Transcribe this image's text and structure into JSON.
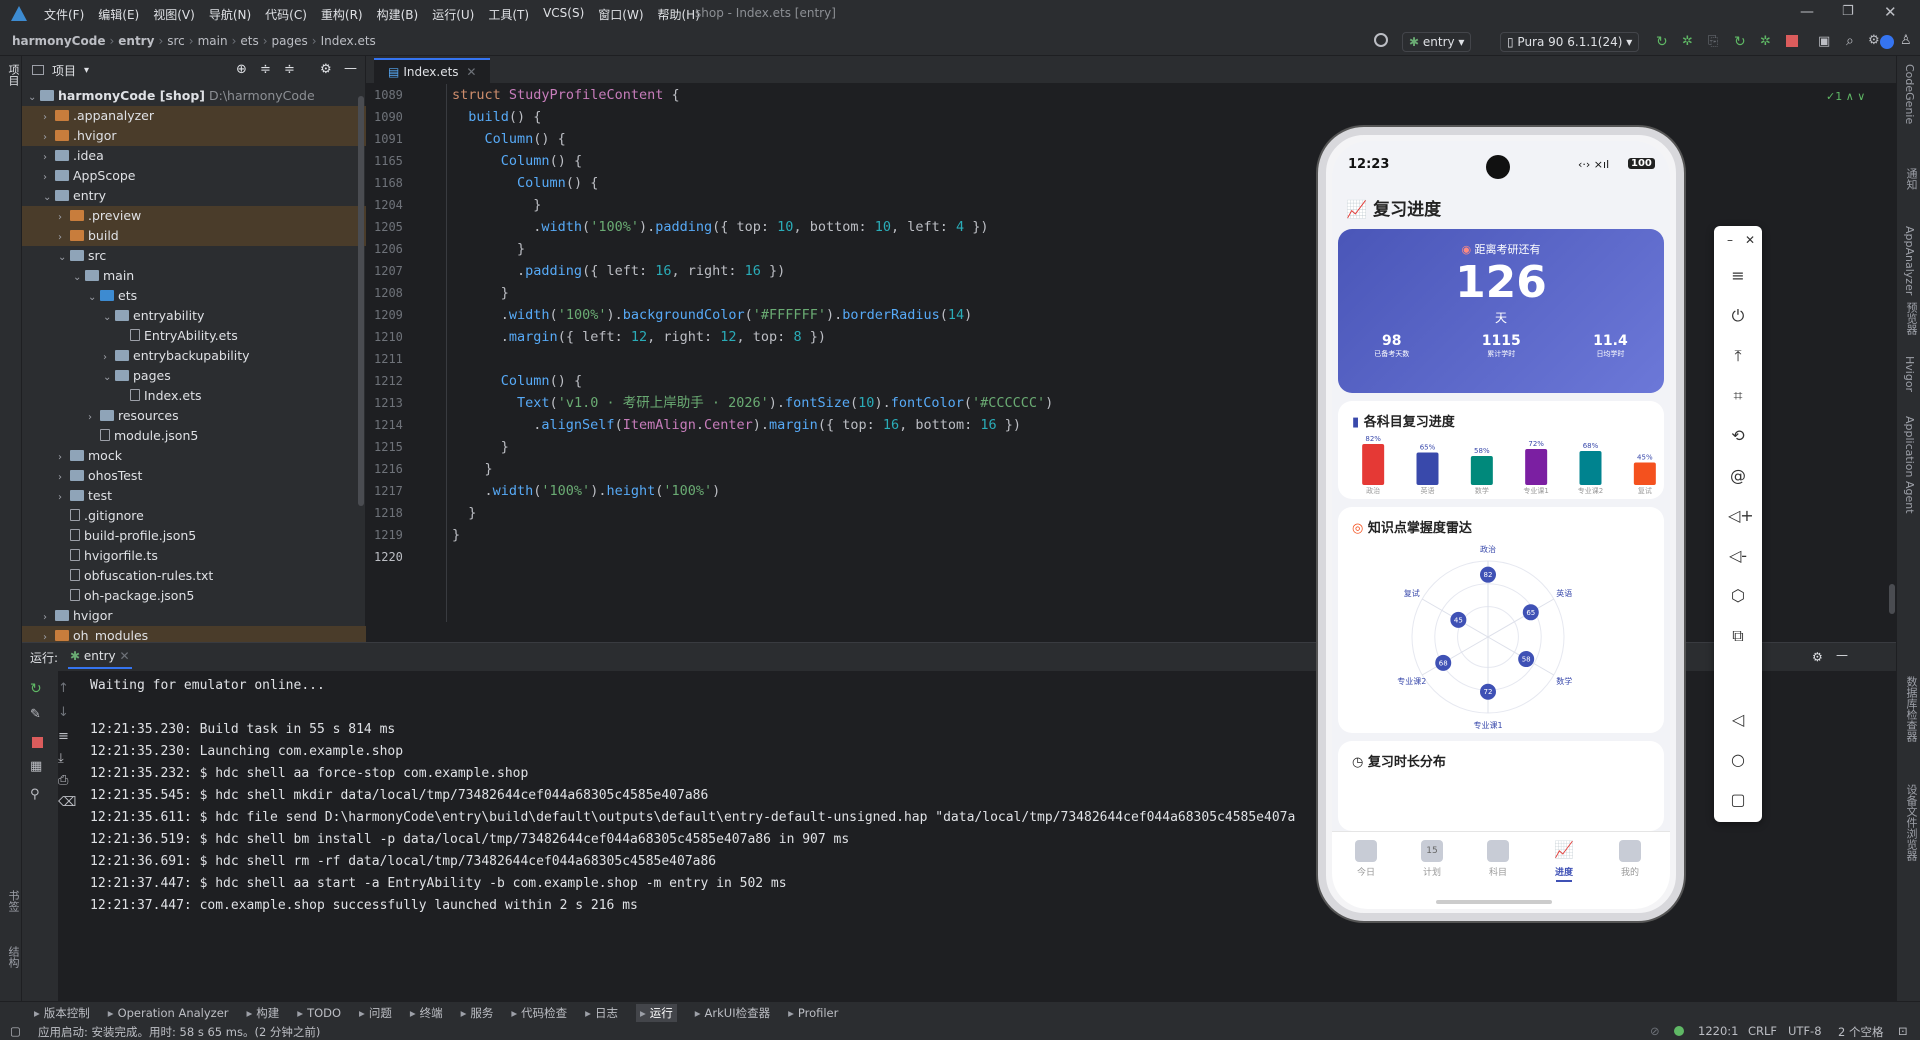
{
  "menu": [
    "文件(F)",
    "编辑(E)",
    "视图(V)",
    "导航(N)",
    "代码(C)",
    "重构(R)",
    "构建(B)",
    "运行(U)",
    "工具(T)",
    "VCS(S)",
    "窗口(W)",
    "帮助(H)"
  ],
  "window_title": "shop - Index.ets [entry]",
  "breadcrumbs": [
    "harmonyCode",
    "entry",
    "src",
    "main",
    "ets",
    "pages",
    "Index.ets"
  ],
  "toolbar": {
    "config": "entry",
    "device": "Pura 90 6.1.1(24)"
  },
  "project": {
    "header": "项目",
    "root_name": "harmonyCode [shop]",
    "root_path": "D:\\harmonyCode",
    "rows": [
      {
        "label": ".appanalyzer",
        "depth": 1,
        "arrow": "›",
        "icon": "ofolder",
        "hl": true
      },
      {
        "label": ".hvigor",
        "depth": 1,
        "arrow": "›",
        "icon": "ofolder",
        "hl": true
      },
      {
        "label": ".idea",
        "depth": 1,
        "arrow": "›",
        "icon": "folder",
        "hl": false
      },
      {
        "label": "AppScope",
        "depth": 1,
        "arrow": "›",
        "icon": "folder",
        "hl": false
      },
      {
        "label": "entry",
        "depth": 1,
        "arrow": "⌄",
        "icon": "folder",
        "hl": false
      },
      {
        "label": ".preview",
        "depth": 2,
        "arrow": "›",
        "icon": "ofolder",
        "hl": true
      },
      {
        "label": "build",
        "depth": 2,
        "arrow": "›",
        "icon": "ofolder",
        "hl": true
      },
      {
        "label": "src",
        "depth": 2,
        "arrow": "⌄",
        "icon": "folder",
        "hl": false
      },
      {
        "label": "main",
        "depth": 3,
        "arrow": "⌄",
        "icon": "folder",
        "hl": false
      },
      {
        "label": "ets",
        "depth": 4,
        "arrow": "⌄",
        "icon": "bfolder",
        "hl": false
      },
      {
        "label": "entryability",
        "depth": 5,
        "arrow": "⌄",
        "icon": "folder",
        "hl": false
      },
      {
        "label": "EntryAbility.ets",
        "depth": 6,
        "arrow": "",
        "icon": "file",
        "hl": false
      },
      {
        "label": "entrybackupability",
        "depth": 5,
        "arrow": "›",
        "icon": "folder",
        "hl": false
      },
      {
        "label": "pages",
        "depth": 5,
        "arrow": "⌄",
        "icon": "folder",
        "hl": false
      },
      {
        "label": "Index.ets",
        "depth": 6,
        "arrow": "",
        "icon": "file",
        "hl": false
      },
      {
        "label": "resources",
        "depth": 4,
        "arrow": "›",
        "icon": "folder",
        "hl": false
      },
      {
        "label": "module.json5",
        "depth": 4,
        "arrow": "",
        "icon": "file",
        "hl": false
      },
      {
        "label": "mock",
        "depth": 2,
        "arrow": "›",
        "icon": "folder",
        "hl": false
      },
      {
        "label": "ohosTest",
        "depth": 2,
        "arrow": "›",
        "icon": "folder",
        "hl": false
      },
      {
        "label": "test",
        "depth": 2,
        "arrow": "›",
        "icon": "folder",
        "hl": false
      },
      {
        "label": ".gitignore",
        "depth": 2,
        "arrow": "",
        "icon": "file",
        "hl": false
      },
      {
        "label": "build-profile.json5",
        "depth": 2,
        "arrow": "",
        "icon": "file",
        "hl": false
      },
      {
        "label": "hvigorfile.ts",
        "depth": 2,
        "arrow": "",
        "icon": "file",
        "hl": false
      },
      {
        "label": "obfuscation-rules.txt",
        "depth": 2,
        "arrow": "",
        "icon": "file",
        "hl": false
      },
      {
        "label": "oh-package.json5",
        "depth": 2,
        "arrow": "",
        "icon": "file",
        "hl": false
      },
      {
        "label": "hvigor",
        "depth": 1,
        "arrow": "›",
        "icon": "folder",
        "hl": false
      },
      {
        "label": "oh_modules",
        "depth": 1,
        "arrow": "›",
        "icon": "ofolder",
        "hl": true
      }
    ]
  },
  "editor": {
    "tab": "Index.ets",
    "lines": [
      {
        "n": "1089",
        "html": "<span class=\"kw\">struct</span> <span class=\"st\">StudyProfileContent</span> {"
      },
      {
        "n": "1090",
        "html": "  <span class=\"fn\">build</span>() {"
      },
      {
        "n": "1091",
        "html": "    <span class=\"fn\">Column</span>() {"
      },
      {
        "n": "1165",
        "html": "      <span class=\"fn\">Column</span>() {"
      },
      {
        "n": "1168",
        "html": "        <span class=\"fn\">Column</span>() {"
      },
      {
        "n": "1204",
        "html": "          }"
      },
      {
        "n": "1205",
        "html": "          .<span class=\"fn\">width</span>(<span class=\"str\">'100%'</span>).<span class=\"fn\">padding</span>({ top: <span class=\"num\">10</span>, bottom: <span class=\"num\">10</span>, left: <span class=\"num\">4</span> })"
      },
      {
        "n": "1206",
        "html": "        }"
      },
      {
        "n": "1207",
        "html": "        .<span class=\"fn\">padding</span>({ left: <span class=\"num\">16</span>, right: <span class=\"num\">16</span> })"
      },
      {
        "n": "1208",
        "html": "      }"
      },
      {
        "n": "1209",
        "html": "      .<span class=\"fn\">width</span>(<span class=\"str\">'100%'</span>).<span class=\"fn\">backgroundColor</span>(<span class=\"str\">'#FFFFFF'</span>).<span class=\"fn\">borderRadius</span>(<span class=\"num\">14</span>)"
      },
      {
        "n": "1210",
        "html": "      .<span class=\"fn\">margin</span>({ left: <span class=\"num\">12</span>, right: <span class=\"num\">12</span>, top: <span class=\"num\">8</span> })"
      },
      {
        "n": "1211",
        "html": ""
      },
      {
        "n": "1212",
        "html": "      <span class=\"fn\">Column</span>() {"
      },
      {
        "n": "1213",
        "html": "        <span class=\"fn\">Text</span>(<span class=\"str\">'v1.0 · 考研上岸助手 · 2026'</span>).<span class=\"fn\">fontSize</span>(<span class=\"num\">10</span>).<span class=\"fn\">fontColor</span>(<span class=\"str\">'#CCCCCC'</span>)"
      },
      {
        "n": "1214",
        "html": "          .<span class=\"fn\">alignSelf</span>(<span class=\"ty\">ItemAlign</span>.<span class=\"ty\">Center</span>).<span class=\"fn\">margin</span>({ top: <span class=\"num\">16</span>, bottom: <span class=\"num\">16</span> })"
      },
      {
        "n": "1215",
        "html": "      }"
      },
      {
        "n": "1216",
        "html": "    }"
      },
      {
        "n": "1217",
        "html": "    .<span class=\"fn\">width</span>(<span class=\"str\">'100%'</span>).<span class=\"fn\">height</span>(<span class=\"str\">'100%'</span>)"
      },
      {
        "n": "1218",
        "html": "  }"
      },
      {
        "n": "1219",
        "html": "}"
      },
      {
        "n": "1220",
        "html": ""
      }
    ],
    "inspection": "1"
  },
  "run": {
    "label": "运行:",
    "tab": "entry",
    "lines": [
      "Waiting for emulator online...",
      "",
      "12:21:35.230: Build task in 55 s 814 ms",
      "12:21:35.230: Launching com.example.shop",
      "12:21:35.232: $ hdc shell aa force-stop com.example.shop",
      "12:21:35.545: $ hdc shell mkdir data/local/tmp/73482644cef044a68305c4585e407a86",
      "12:21:35.611: $ hdc file send D:\\harmonyCode\\entry\\build\\default\\outputs\\default\\entry-default-unsigned.hap \"data/local/tmp/73482644cef044a68305c4585e407a",
      "12:21:36.519: $ hdc shell bm install -p data/local/tmp/73482644cef044a68305c4585e407a86 in 907 ms",
      "12:21:36.691: $ hdc shell rm -rf data/local/tmp/73482644cef044a68305c4585e407a86",
      "12:21:37.447: $ hdc shell aa start -a EntryAbility -b com.example.shop -m entry in 502 ms",
      "12:21:37.447: com.example.shop successfully launched within 2 s 216 ms"
    ]
  },
  "bottom_tools": [
    "版本控制",
    "Operation Analyzer",
    "构建",
    "TODO",
    "问题",
    "终端",
    "服务",
    "代码检查",
    "日志",
    "运行",
    "ArkUI检查器",
    "Profiler"
  ],
  "status": {
    "message": "应用启动: 安装完成。用时: 58 s 65 ms。(2 分钟之前)",
    "position": "1220:1",
    "line_sep": "CRLF",
    "encoding": "UTF-8",
    "indent": "2 个空格"
  },
  "left_strip": [
    "项目",
    "书签",
    "结构"
  ],
  "right_strip": [
    "CodeGenie",
    "通知",
    "AppAnalyzer",
    "预览器",
    "Hvigor",
    "Application Agent",
    "数据库检查器",
    "设备文件浏览器"
  ],
  "phone": {
    "time": "12:23",
    "battery": "100",
    "page_title": "复习进度",
    "countdown": {
      "label": "距离考研还有",
      "value": "126",
      "unit": "天",
      "stats": [
        {
          "value": "98",
          "label": "已备考天数"
        },
        {
          "value": "1115",
          "label": "累计学时"
        },
        {
          "value": "11.4",
          "label": "日均学时"
        }
      ]
    },
    "bar_card_title": "各科目复习进度",
    "radar_card_title": "知识点掌握度雷达",
    "next_card_title": "复习时长分布",
    "tabs": [
      "今日",
      "计划",
      "科目",
      "进度",
      "我的"
    ],
    "calendar_day": "15",
    "active_tab": 3
  },
  "chart_data": [
    {
      "type": "bar",
      "title": "各科目复习进度",
      "categories": [
        "政治",
        "英语",
        "数学",
        "专业课1",
        "专业课2",
        "复试"
      ],
      "values": [
        82,
        65,
        58,
        72,
        68,
        45
      ],
      "value_labels": [
        "82%",
        "65%",
        "58%",
        "72%",
        "68%",
        "45%"
      ],
      "colors": [
        "#e53935",
        "#3949ab",
        "#00897b",
        "#7b1fa2",
        "#00838f",
        "#f4511e"
      ],
      "ylim": [
        0,
        100
      ]
    },
    {
      "type": "radar",
      "title": "知识点掌握度雷达",
      "categories": [
        "政治",
        "英语",
        "数学",
        "专业课1",
        "专业课2",
        "复试"
      ],
      "values": [
        82,
        65,
        58,
        72,
        68,
        45
      ],
      "rmax": 100
    }
  ],
  "colors": {
    "accent": "#3574f0",
    "count_card": "#5561c4",
    "active_tab": "#3f51b5",
    "radar_point": "#3f51b5"
  }
}
